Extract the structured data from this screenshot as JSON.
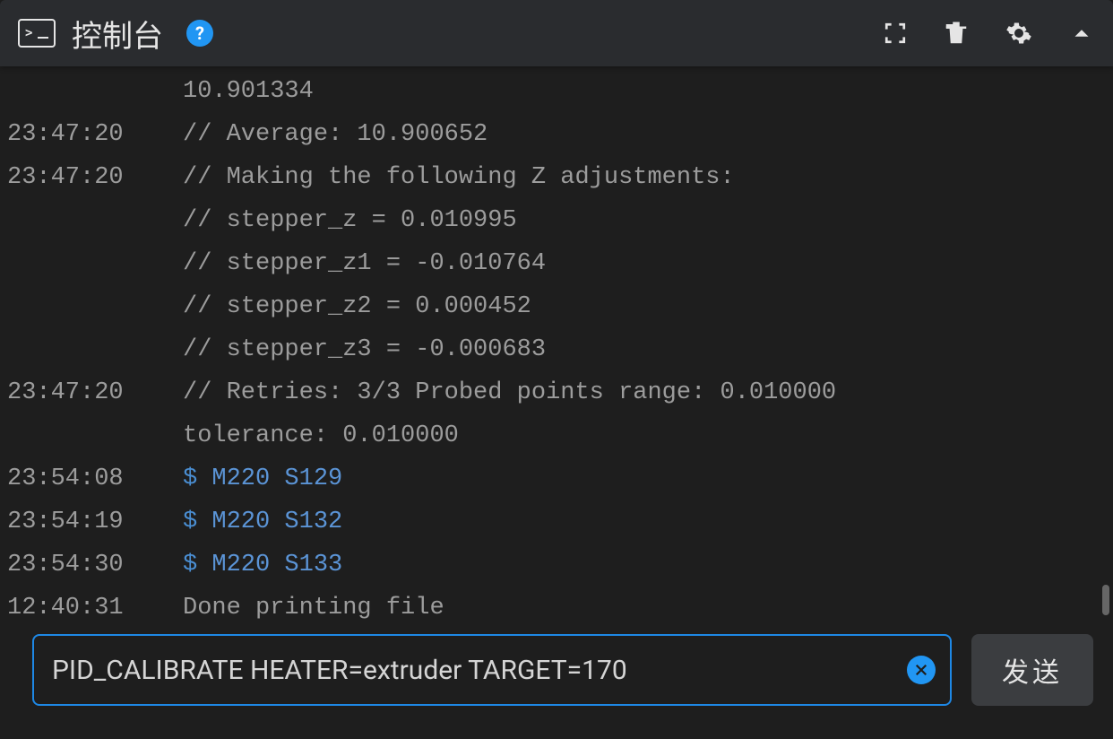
{
  "header": {
    "title": "控制台",
    "help": "?",
    "icons": {
      "fullscreen": "fullscreen",
      "trash": "trash",
      "settings": "settings",
      "collapse": "collapse"
    }
  },
  "console": {
    "lines": [
      {
        "ts": "",
        "type": "text",
        "text": "10.901334"
      },
      {
        "ts": "23:47:20",
        "type": "text",
        "text": "// Average: 10.900652"
      },
      {
        "ts": "23:47:20",
        "type": "text",
        "text": "// Making the following Z adjustments:"
      },
      {
        "ts": "",
        "type": "text",
        "text": "// stepper_z = 0.010995"
      },
      {
        "ts": "",
        "type": "text",
        "text": "// stepper_z1 = -0.010764"
      },
      {
        "ts": "",
        "type": "text",
        "text": "// stepper_z2 = 0.000452"
      },
      {
        "ts": "",
        "type": "text",
        "text": "// stepper_z3 = -0.000683"
      },
      {
        "ts": "23:47:20",
        "type": "text",
        "text": "// Retries: 3/3 Probed points range: 0.010000"
      },
      {
        "ts": "",
        "type": "text",
        "text": "tolerance: 0.010000"
      },
      {
        "ts": "23:54:08",
        "type": "cmd",
        "text": "M220 S129"
      },
      {
        "ts": "23:54:19",
        "type": "cmd",
        "text": "M220 S132"
      },
      {
        "ts": "23:54:30",
        "type": "cmd",
        "text": "M220 S133"
      },
      {
        "ts": "12:40:31",
        "type": "text",
        "text": "Done printing file"
      }
    ]
  },
  "input": {
    "value": "PID_CALIBRATE HEATER=extruder TARGET=170",
    "send_label": "发送",
    "dollar": "$"
  }
}
